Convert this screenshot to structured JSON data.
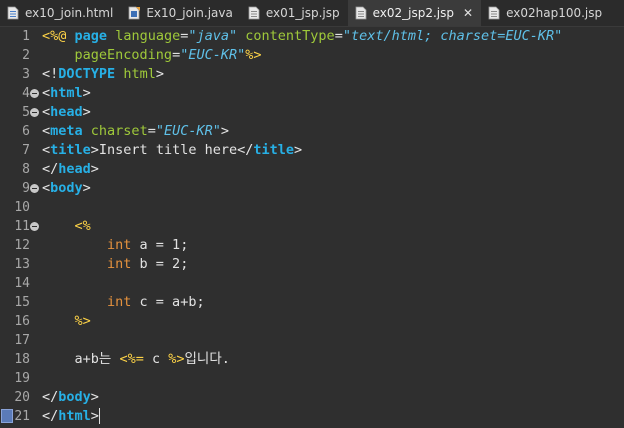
{
  "tabs": [
    {
      "label": "ex10_join.html",
      "icon": "html-file-icon",
      "active": false
    },
    {
      "label": "Ex10_join.java",
      "icon": "java-file-icon",
      "active": false
    },
    {
      "label": "ex01_jsp.jsp",
      "icon": "jsp-file-icon",
      "active": false
    },
    {
      "label": "ex02_jsp2.jsp",
      "icon": "jsp-file-icon",
      "active": true,
      "close": "✕"
    },
    {
      "label": "ex02hap100.jsp",
      "icon": "jsp-file-icon",
      "active": false
    }
  ],
  "lines": [
    {
      "n": "1",
      "tokens": [
        [
          "dl",
          "<%@"
        ],
        [
          "pu",
          " "
        ],
        [
          "kw",
          "page"
        ],
        [
          "pu",
          " "
        ],
        [
          "at",
          "language"
        ],
        [
          "pu",
          "="
        ],
        [
          "st",
          "\"java\""
        ],
        [
          "pu",
          " "
        ],
        [
          "at",
          "contentType"
        ],
        [
          "pu",
          "="
        ],
        [
          "st",
          "\"text/html; charset=EUC-KR\""
        ]
      ]
    },
    {
      "n": "2",
      "tokens": [
        [
          "pu",
          "    "
        ],
        [
          "at",
          "pageEncoding"
        ],
        [
          "pu",
          "="
        ],
        [
          "st",
          "\"EUC-KR\""
        ],
        [
          "dl",
          "%>"
        ]
      ]
    },
    {
      "n": "3",
      "tokens": [
        [
          "tg",
          "<!"
        ],
        [
          "kw",
          "DOCTYPE"
        ],
        [
          "pu",
          " "
        ],
        [
          "at",
          "html"
        ],
        [
          "tg",
          ">"
        ]
      ]
    },
    {
      "n": "4",
      "fold": true,
      "tokens": [
        [
          "tg",
          "<"
        ],
        [
          "kw",
          "html"
        ],
        [
          "tg",
          ">"
        ]
      ]
    },
    {
      "n": "5",
      "fold": true,
      "tokens": [
        [
          "tg",
          "<"
        ],
        [
          "kw",
          "head"
        ],
        [
          "tg",
          ">"
        ]
      ]
    },
    {
      "n": "6",
      "tokens": [
        [
          "tg",
          "<"
        ],
        [
          "kw",
          "meta"
        ],
        [
          "pu",
          " "
        ],
        [
          "at",
          "charset"
        ],
        [
          "pu",
          "="
        ],
        [
          "st",
          "\"EUC-KR\""
        ],
        [
          "tg",
          ">"
        ]
      ]
    },
    {
      "n": "7",
      "tokens": [
        [
          "tg",
          "<"
        ],
        [
          "kw",
          "title"
        ],
        [
          "tg",
          ">"
        ],
        [
          "tx",
          "Insert title here"
        ],
        [
          "tg",
          "</"
        ],
        [
          "kw",
          "title"
        ],
        [
          "tg",
          ">"
        ]
      ]
    },
    {
      "n": "8",
      "tokens": [
        [
          "tg",
          "</"
        ],
        [
          "kw",
          "head"
        ],
        [
          "tg",
          ">"
        ]
      ]
    },
    {
      "n": "9",
      "fold": true,
      "tokens": [
        [
          "tg",
          "<"
        ],
        [
          "kw",
          "body"
        ],
        [
          "tg",
          ">"
        ]
      ]
    },
    {
      "n": "10",
      "tokens": []
    },
    {
      "n": "11",
      "fold": true,
      "tokens": [
        [
          "pu",
          "    "
        ],
        [
          "dl",
          "<%"
        ]
      ]
    },
    {
      "n": "12",
      "tokens": [
        [
          "pu",
          "        "
        ],
        [
          "jk",
          "int"
        ],
        [
          "tx",
          " a = 1;"
        ]
      ]
    },
    {
      "n": "13",
      "tokens": [
        [
          "pu",
          "        "
        ],
        [
          "jk",
          "int"
        ],
        [
          "tx",
          " b = 2;"
        ]
      ]
    },
    {
      "n": "14",
      "tokens": []
    },
    {
      "n": "15",
      "tokens": [
        [
          "pu",
          "        "
        ],
        [
          "jk",
          "int"
        ],
        [
          "tx",
          " c = a+b;"
        ]
      ]
    },
    {
      "n": "16",
      "tokens": [
        [
          "pu",
          "    "
        ],
        [
          "dl",
          "%>"
        ]
      ]
    },
    {
      "n": "17",
      "tokens": []
    },
    {
      "n": "18",
      "tokens": [
        [
          "pu",
          "    "
        ],
        [
          "tx",
          "a+b는 "
        ],
        [
          "dl",
          "<%="
        ],
        [
          "tx",
          " c "
        ],
        [
          "dl",
          "%>"
        ],
        [
          "tx",
          "입니다."
        ]
      ]
    },
    {
      "n": "19",
      "tokens": []
    },
    {
      "n": "20",
      "tokens": [
        [
          "tg",
          "</"
        ],
        [
          "kw",
          "body"
        ],
        [
          "tg",
          ">"
        ]
      ]
    },
    {
      "n": "21",
      "bookmark": true,
      "cursor": true,
      "tokens": [
        [
          "tg",
          "</"
        ],
        [
          "kw",
          "html"
        ],
        [
          "tg",
          ">"
        ]
      ]
    }
  ]
}
